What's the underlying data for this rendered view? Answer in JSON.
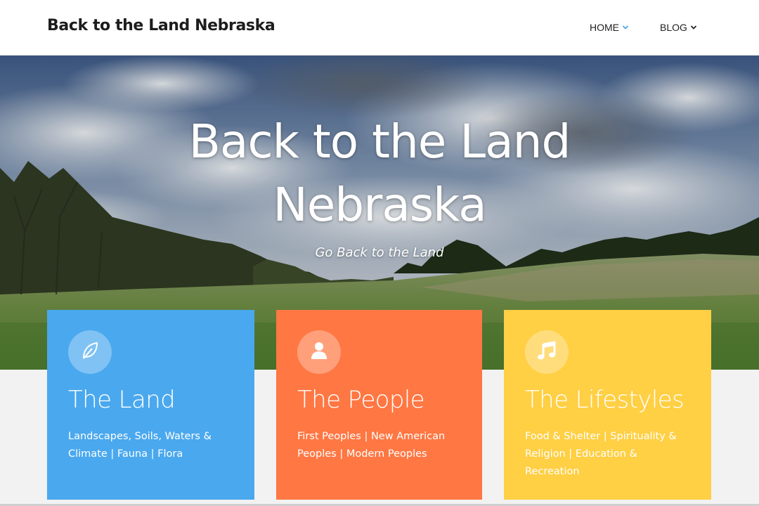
{
  "header": {
    "site_title": "Back to the Land Nebraska",
    "nav": [
      {
        "label": "HOME",
        "chevron_color": "#4aa8ee"
      },
      {
        "label": "BLOG",
        "chevron_color": "#222222"
      }
    ]
  },
  "hero": {
    "title_line1": "Back to the Land",
    "title_line2": "Nebraska",
    "subtitle": "Go Back to the Land"
  },
  "cards": [
    {
      "icon": "leaf-icon",
      "title": "The Land",
      "description": "Landscapes, Soils, Waters & Climate | Fauna | Flora",
      "color": "#4aa8ee"
    },
    {
      "icon": "person-icon",
      "title": "The People",
      "description": "First Peoples | New American Peoples | Modern Peoples",
      "color": "#ff7743"
    },
    {
      "icon": "music-note-icon",
      "title": "The Lifestyles",
      "description": "Food & Shelter | Spirituality & Religion | Education & Recreation",
      "color": "#ffcf44"
    }
  ]
}
